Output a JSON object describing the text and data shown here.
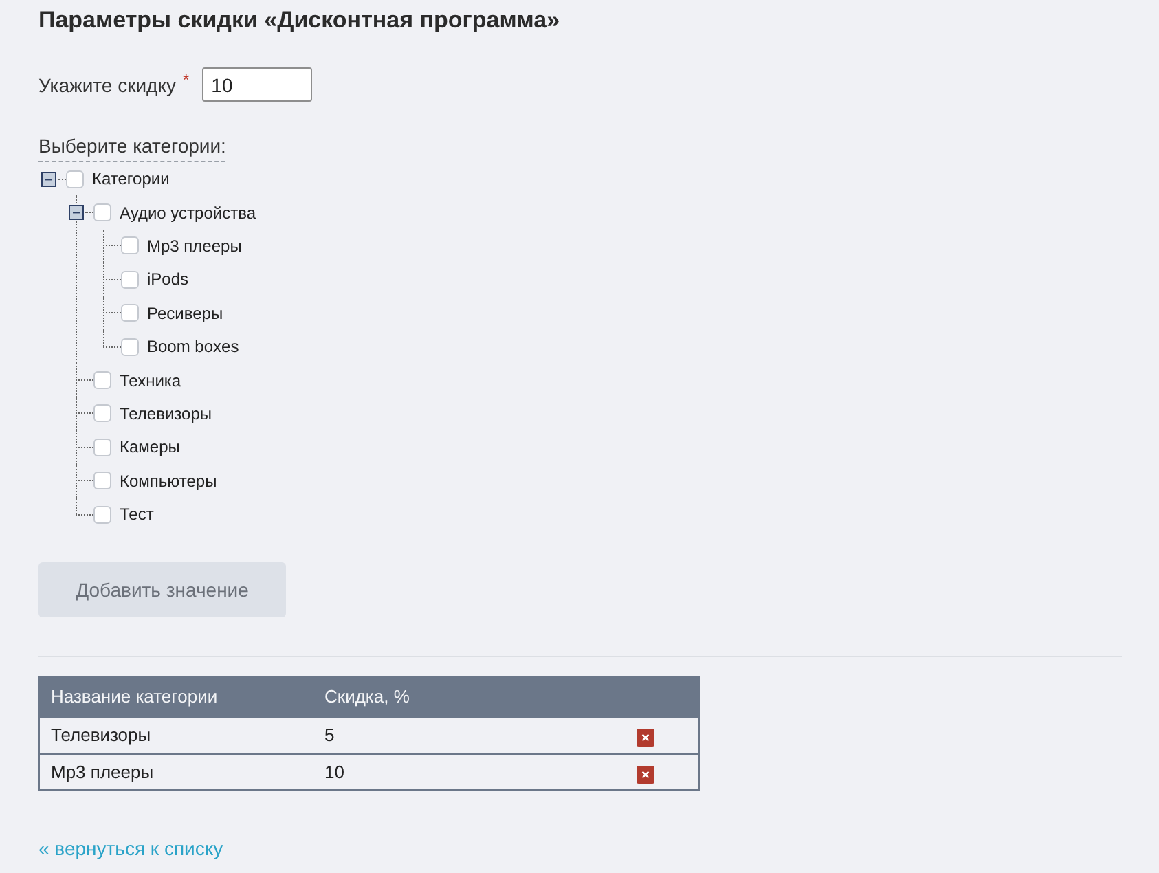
{
  "title": "Параметры скидки «Дисконтная программа»",
  "discount_field": {
    "label": "Укажите скидку",
    "required_mark": "*",
    "value": "10"
  },
  "categories": {
    "label": "Выберите категории:",
    "tree": [
      {
        "label": "Категории",
        "checked": false,
        "expanded": true,
        "children": [
          {
            "label": "Аудио устройства",
            "checked": false,
            "expanded": true,
            "children": [
              {
                "label": "Mp3 плееры",
                "checked": false
              },
              {
                "label": "iPods",
                "checked": false
              },
              {
                "label": "Ресиверы",
                "checked": false
              },
              {
                "label": "Boom boxes",
                "checked": false
              }
            ]
          },
          {
            "label": "Техника",
            "checked": false
          },
          {
            "label": "Телевизоры",
            "checked": false
          },
          {
            "label": "Камеры",
            "checked": false
          },
          {
            "label": "Компьютеры",
            "checked": false
          },
          {
            "label": "Тест",
            "checked": false
          }
        ]
      }
    ]
  },
  "add_button": {
    "label": "Добавить значение"
  },
  "table": {
    "columns": [
      "Название категории",
      "Скидка, %"
    ],
    "rows": [
      {
        "cells": [
          "Телевизоры",
          "5"
        ]
      },
      {
        "cells": [
          "Mp3 плееры",
          "10"
        ]
      }
    ]
  },
  "back_link": "« вернуться к списку"
}
